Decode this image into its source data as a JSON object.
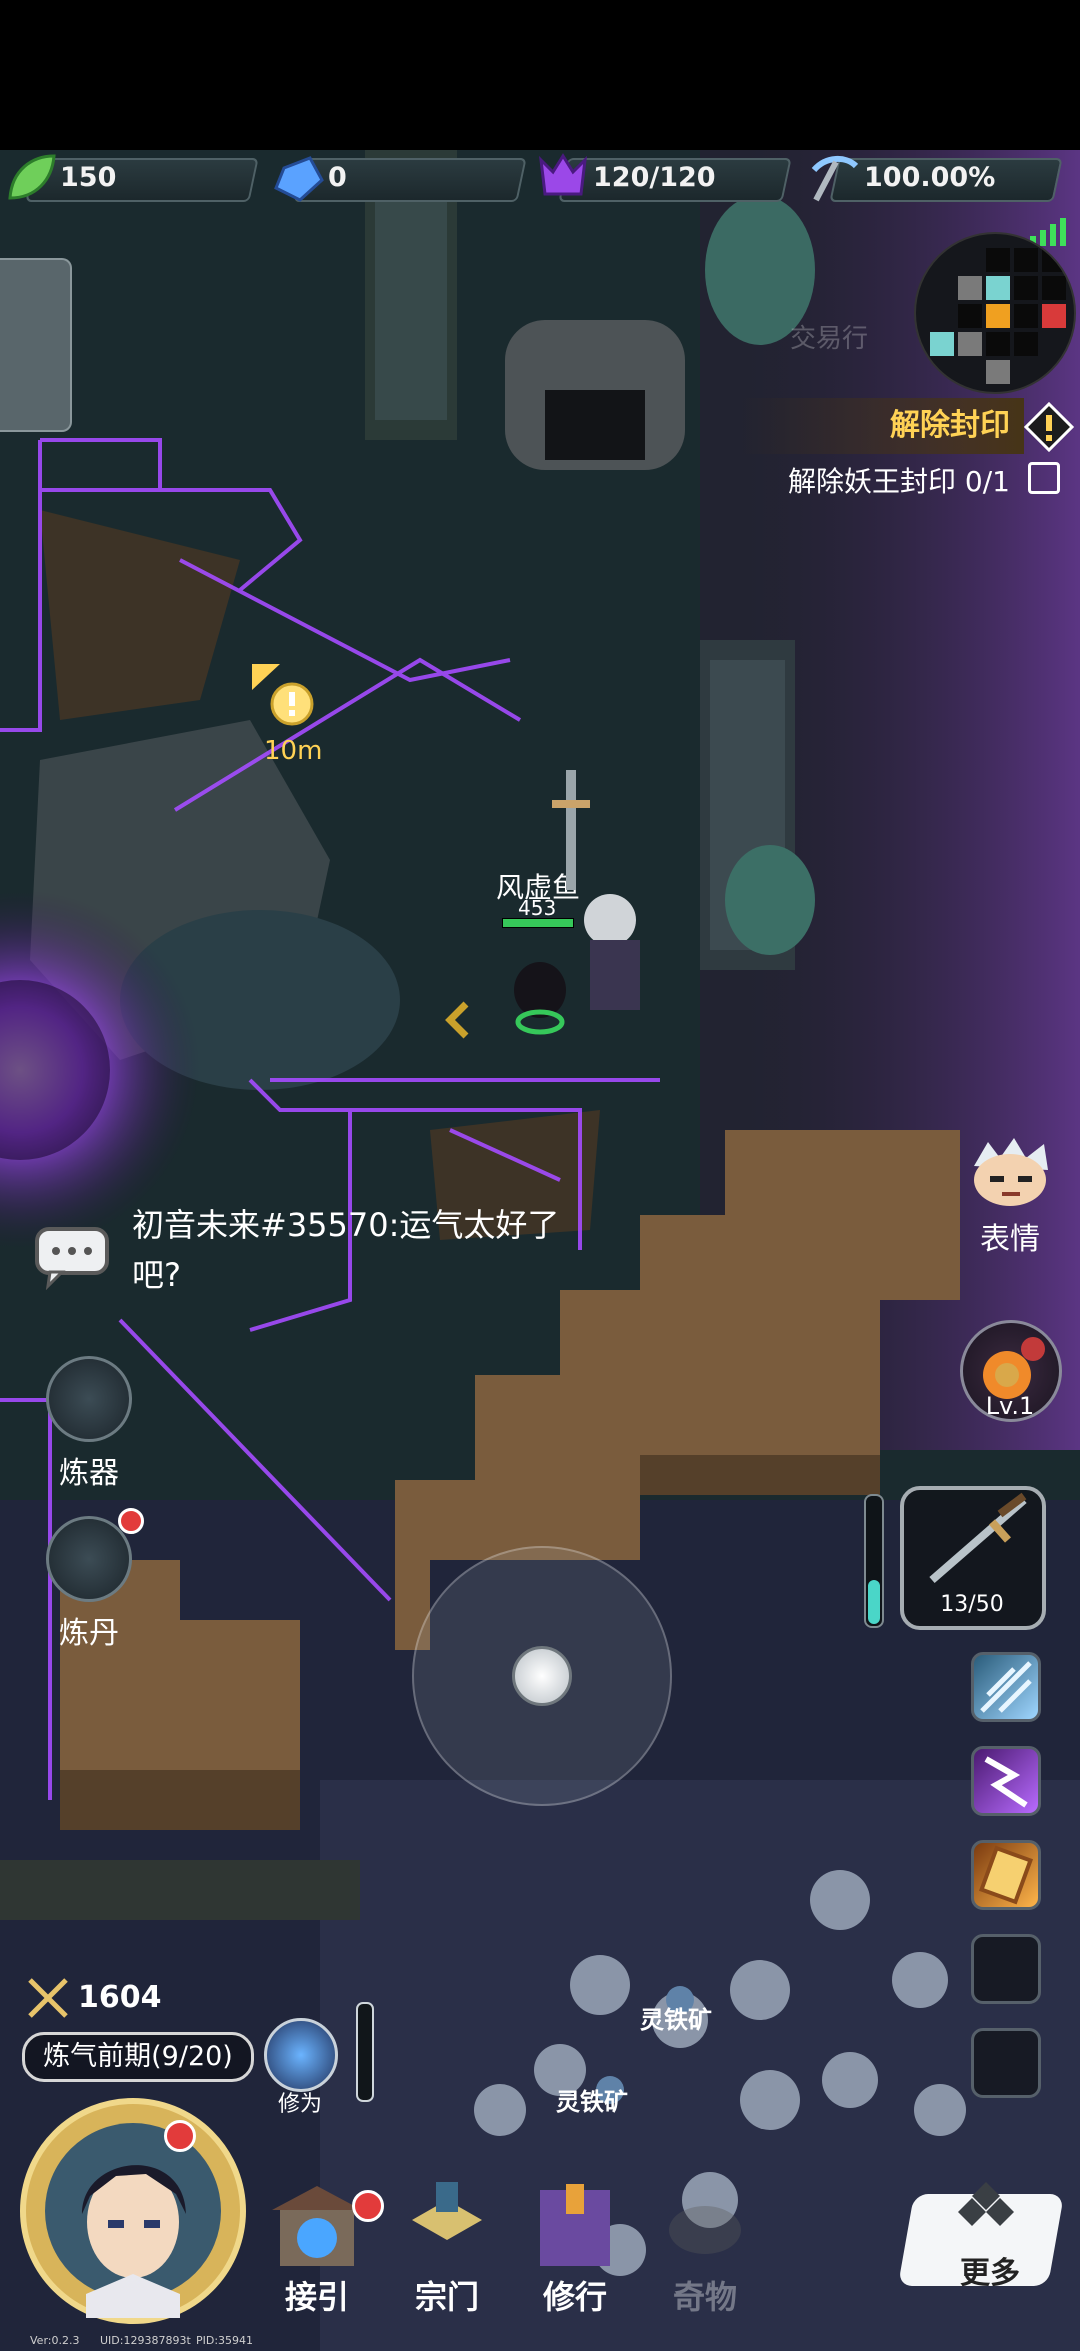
{
  "resources": [
    {
      "icon": "leaf-icon",
      "value": "150"
    },
    {
      "icon": "crystal-icon",
      "value": "0"
    },
    {
      "icon": "demon-icon",
      "value": "120/120"
    },
    {
      "icon": "pickaxe-icon",
      "value": "100.00%"
    }
  ],
  "trade_label": "交易行",
  "quest": {
    "title": "解除封印",
    "task": "解除妖王封印 0/1"
  },
  "marker_distance": "10m",
  "player": {
    "name": "风虚鱼",
    "hp": "453"
  },
  "chat": {
    "message": "初音未来#35570:运气太好了吧?"
  },
  "left_buttons": [
    {
      "label": "炼器"
    },
    {
      "label": "炼丹"
    }
  ],
  "right_panel": {
    "emote_label": "表情",
    "gourd_level": "Lv.1",
    "weapon_durability": "13/50"
  },
  "ore_labels": [
    "灵铁矿",
    "灵铁矿"
  ],
  "stats": {
    "power": "1604",
    "realm": "炼气前期(9/20)",
    "cultivation_label": "修为"
  },
  "bottom_menu": [
    {
      "label": "接引"
    },
    {
      "label": "宗门"
    },
    {
      "label": "修行"
    },
    {
      "label": "奇物"
    }
  ],
  "more_label": "更多",
  "footer": {
    "version": "Ver:0.2.3",
    "uid": "UID:129387893t",
    "pid": "PID:35941"
  },
  "colors": {
    "accent_gold": "#ffd255",
    "seal_purple": "#a54cff",
    "hp_green": "#36c85a"
  }
}
